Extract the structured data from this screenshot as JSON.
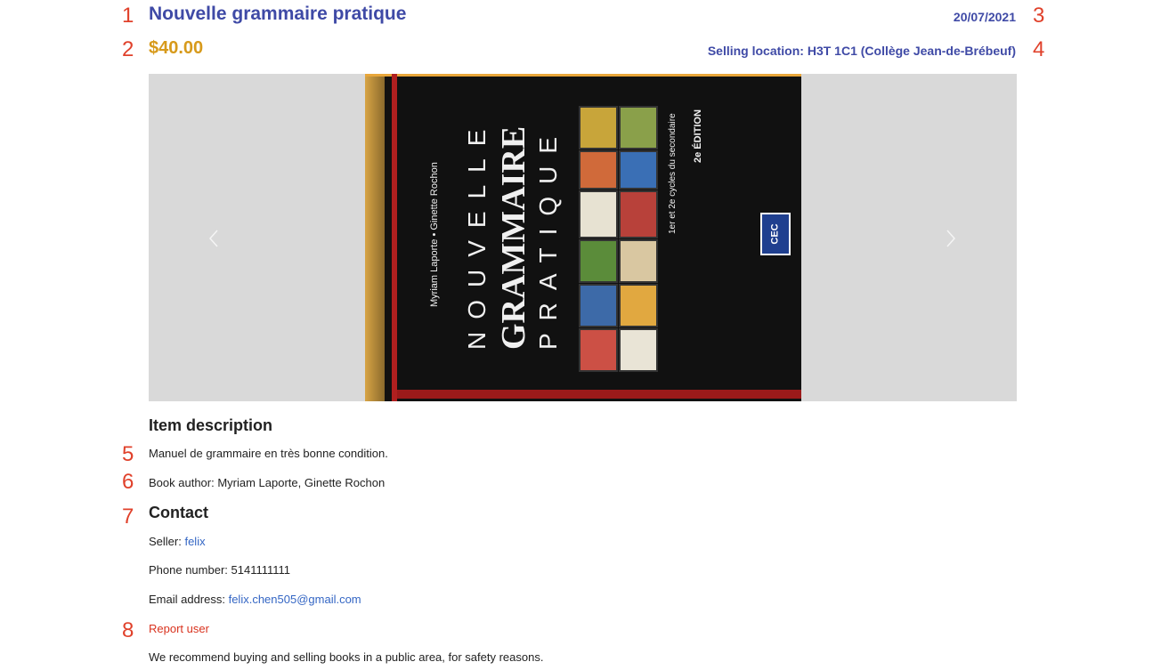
{
  "annotations": [
    "1",
    "2",
    "3",
    "4",
    "5",
    "6",
    "7",
    "8"
  ],
  "listing": {
    "title": "Nouvelle grammaire pratique",
    "price": "$40.00",
    "date": "20/07/2021",
    "location": "Selling location: H3T 1C1 (Collège Jean-de-Brébeuf)"
  },
  "image": {
    "author_line": "Myriam Laporte • Ginette Rochon",
    "word1": "NOUVELLE",
    "word2": "GRAMMAIRE",
    "word3": "PRATIQUE",
    "cycles": "1er et 2e cycles du secondaire",
    "edition": "2e ÉDITION",
    "publisher": "CEC",
    "prev_icon": "chevron-left-icon",
    "next_icon": "chevron-right-icon"
  },
  "description": {
    "heading": "Item description",
    "text": "Manuel de grammaire en très bonne condition.",
    "author": "Book author: Myriam Laporte, Ginette Rochon"
  },
  "contact": {
    "heading": "Contact",
    "seller_label": "Seller: ",
    "seller": "felix",
    "phone": "Phone number: 5141111111",
    "email_label": "Email address: ",
    "email": "felix.chen505@gmail.com",
    "report": "Report user",
    "safety": "We recommend buying and selling books in a public area, for safety reasons."
  },
  "colors": {
    "accent": "#3f4aa6",
    "price": "#d79a1b",
    "link": "#3466c4",
    "report": "#d9331f",
    "annotation": "#e0412b"
  }
}
